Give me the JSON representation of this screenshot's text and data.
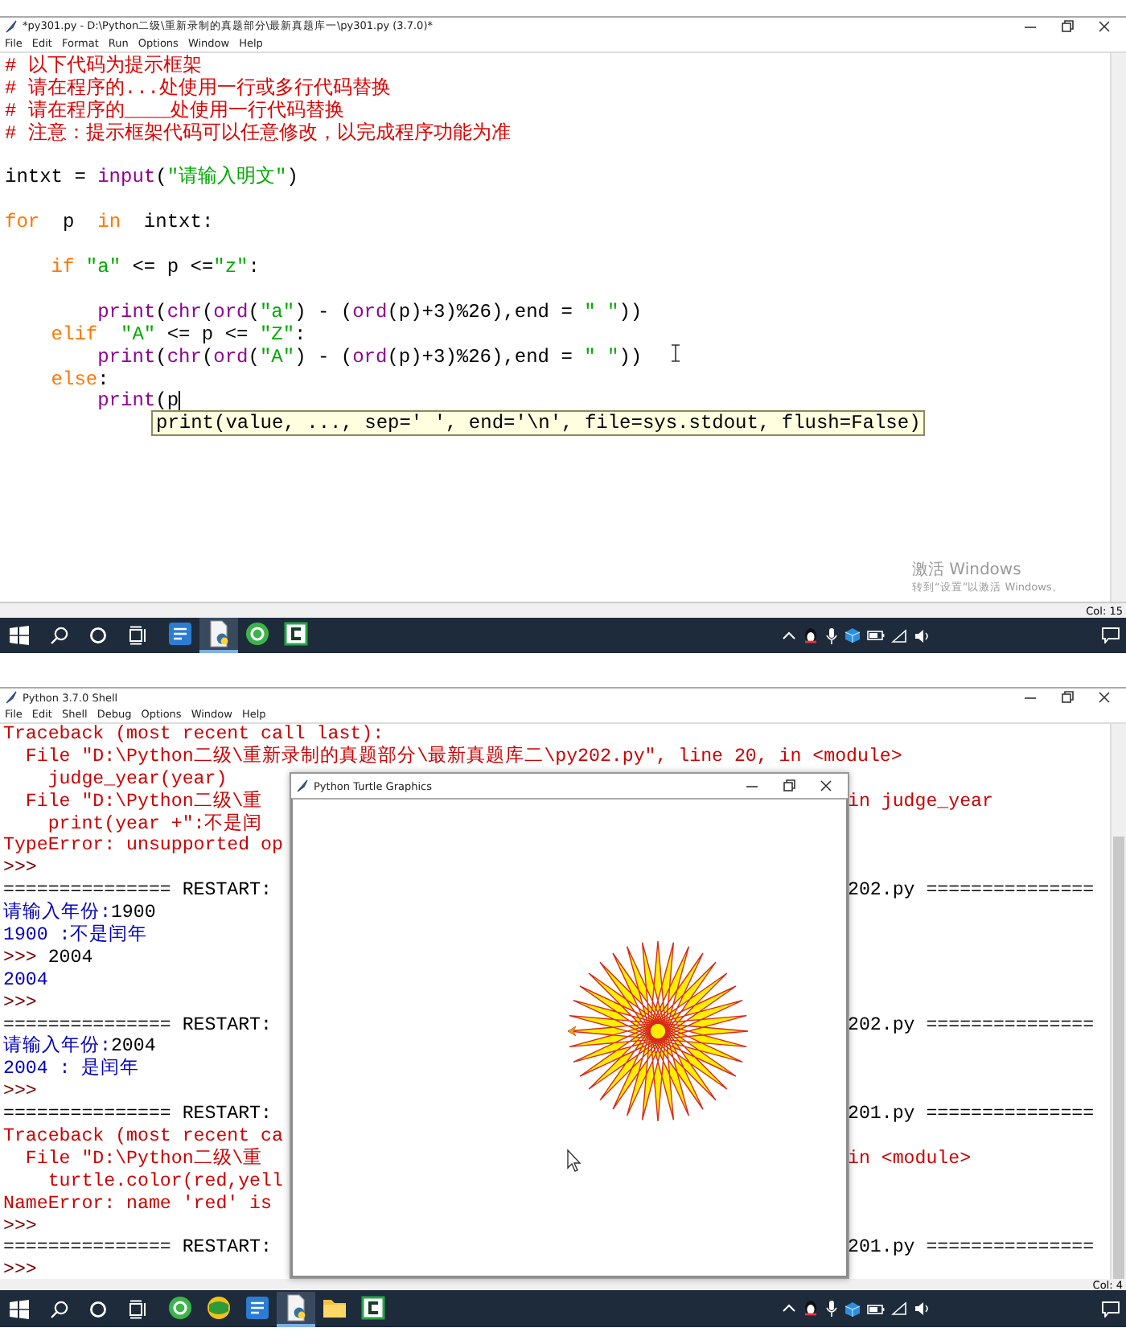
{
  "editor_window": {
    "title": "*py301.py - D:\\Python二级\\重新录制的真题部分\\最新真题库一\\py301.py (3.7.0)*",
    "menu": [
      "File",
      "Edit",
      "Format",
      "Run",
      "Options",
      "Window",
      "Help"
    ],
    "lines": [
      {
        "blank_before": false,
        "caret": false,
        "tokens": [
          {
            "text": "# 以下代码为提示框架",
            "kind": "comment"
          }
        ]
      },
      {
        "blank_before": false,
        "caret": false,
        "tokens": [
          {
            "text": "# 请在程序的...处使用一行或多行代码替换",
            "kind": "comment"
          }
        ]
      },
      {
        "blank_before": false,
        "caret": false,
        "tokens": [
          {
            "text": "# 请在程序的____处使用一行代码替换",
            "kind": "comment"
          }
        ]
      },
      {
        "blank_before": false,
        "caret": false,
        "tokens": [
          {
            "text": "# 注意：提示框架代码可以任意修改，以完成程序功能为准",
            "kind": "comment"
          }
        ]
      },
      {
        "blank_before": true,
        "caret": false,
        "tokens": [
          {
            "text": "intxt = ",
            "kind": "plain"
          },
          {
            "text": "input",
            "kind": "builtin"
          },
          {
            "text": "(",
            "kind": "plain"
          },
          {
            "text": "\"请输入明文\"",
            "kind": "string"
          },
          {
            "text": ")",
            "kind": "plain"
          }
        ]
      },
      {
        "blank_before": true,
        "caret": false,
        "tokens": [
          {
            "text": "for",
            "kind": "keyword"
          },
          {
            "text": "  p  ",
            "kind": "plain"
          },
          {
            "text": "in",
            "kind": "keyword"
          },
          {
            "text": "  intxt:",
            "kind": "plain"
          }
        ]
      },
      {
        "blank_before": true,
        "caret": false,
        "tokens": [
          {
            "text": "    if ",
            "kind": "keyword"
          },
          {
            "text": "\"a\"",
            "kind": "string"
          },
          {
            "text": " <= p <=",
            "kind": "plain"
          },
          {
            "text": "\"z\"",
            "kind": "string"
          },
          {
            "text": ":",
            "kind": "plain"
          }
        ]
      },
      {
        "blank_before": true,
        "caret": false,
        "tokens": [
          {
            "text": "        print",
            "kind": "builtin"
          },
          {
            "text": "(",
            "kind": "plain"
          },
          {
            "text": "chr",
            "kind": "builtin"
          },
          {
            "text": "(",
            "kind": "plain"
          },
          {
            "text": "ord",
            "kind": "builtin"
          },
          {
            "text": "(",
            "kind": "plain"
          },
          {
            "text": "\"a\"",
            "kind": "string"
          },
          {
            "text": ") - (",
            "kind": "plain"
          },
          {
            "text": "ord",
            "kind": "builtin"
          },
          {
            "text": "(p)+3)%26),end = ",
            "kind": "plain"
          },
          {
            "text": "\" \"",
            "kind": "string"
          },
          {
            "text": "))",
            "kind": "plain"
          }
        ]
      },
      {
        "blank_before": false,
        "caret": false,
        "tokens": [
          {
            "text": "    elif  ",
            "kind": "keyword"
          },
          {
            "text": "\"A\"",
            "kind": "string"
          },
          {
            "text": " <= p <= ",
            "kind": "plain"
          },
          {
            "text": "\"Z\"",
            "kind": "string"
          },
          {
            "text": ":",
            "kind": "plain"
          }
        ]
      },
      {
        "blank_before": false,
        "caret": false,
        "tokens": [
          {
            "text": "        print",
            "kind": "builtin"
          },
          {
            "text": "(",
            "kind": "plain"
          },
          {
            "text": "chr",
            "kind": "builtin"
          },
          {
            "text": "(",
            "kind": "plain"
          },
          {
            "text": "ord",
            "kind": "builtin"
          },
          {
            "text": "(",
            "kind": "plain"
          },
          {
            "text": "\"A\"",
            "kind": "string"
          },
          {
            "text": ") - (",
            "kind": "plain"
          },
          {
            "text": "ord",
            "kind": "builtin"
          },
          {
            "text": "(p)+3)%26),end = ",
            "kind": "plain"
          },
          {
            "text": "\" \"",
            "kind": "string"
          },
          {
            "text": "))",
            "kind": "plain"
          }
        ]
      },
      {
        "blank_before": false,
        "caret": false,
        "tokens": [
          {
            "text": "    else",
            "kind": "keyword"
          },
          {
            "text": ":",
            "kind": "plain"
          }
        ]
      },
      {
        "blank_before": false,
        "caret": true,
        "tokens": [
          {
            "text": "        print",
            "kind": "builtin"
          },
          {
            "text": "(p",
            "kind": "plain"
          }
        ]
      }
    ],
    "tooltip": "print(value, ..., sep=' ', end='\\n', file=sys.stdout, flush=False)",
    "status": "Col: 15"
  },
  "activation_notice": {
    "title": "激活 Windows",
    "hint": "转到“设置”以激活 Windows。"
  },
  "taskbar_top": {
    "apps": [
      {
        "kind": "word",
        "selected": false
      },
      {
        "kind": "python",
        "selected": true
      },
      {
        "kind": "green-circle",
        "selected": false
      },
      {
        "kind": "c-app",
        "selected": false
      }
    ]
  },
  "shell_window": {
    "title": "Python 3.7.0 Shell",
    "menu": [
      "File",
      "Edit",
      "Shell",
      "Debug",
      "Options",
      "Window",
      "Help"
    ],
    "lines": [
      {
        "segments": [
          {
            "text": "Traceback (most recent call last):",
            "kind": "error"
          }
        ]
      },
      {
        "segments": [
          {
            "text": "  File \"D:\\Python二级\\重新录制的真题部分\\最新真题库二\\py202.py\", line 20, in <module>",
            "kind": "error"
          }
        ]
      },
      {
        "segments": [
          {
            "text": "    judge_year(year)",
            "kind": "error"
          }
        ]
      },
      {
        "segments": [
          {
            "text": "  File \"D:\\Python二级\\重",
            "kind": "error"
          }
        ],
        "tail": {
          "text": "in judge_year",
          "kind": "error"
        }
      },
      {
        "segments": [
          {
            "text": "    print(year +\":不是闰",
            "kind": "error"
          }
        ]
      },
      {
        "segments": [
          {
            "text": "TypeError: unsupported op",
            "kind": "error"
          }
        ]
      },
      {
        "segments": [
          {
            "text": ">>>",
            "kind": "prompt"
          }
        ]
      },
      {
        "segments": [
          {
            "text": "=============== RESTART:",
            "kind": "plain"
          }
        ],
        "tail": {
          "text": "202.py ===============",
          "kind": "plain"
        }
      },
      {
        "segments": [
          {
            "text": "请输入年份:",
            "kind": "output"
          },
          {
            "text": "1900",
            "kind": "plain"
          }
        ]
      },
      {
        "segments": [
          {
            "text": "1900 :不是闰年",
            "kind": "output"
          }
        ]
      },
      {
        "segments": [
          {
            "text": ">>> ",
            "kind": "prompt"
          },
          {
            "text": "2004",
            "kind": "plain"
          }
        ]
      },
      {
        "segments": [
          {
            "text": "2004",
            "kind": "output"
          }
        ]
      },
      {
        "segments": [
          {
            "text": ">>>",
            "kind": "prompt"
          }
        ]
      },
      {
        "segments": [
          {
            "text": "=============== RESTART:",
            "kind": "plain"
          }
        ],
        "tail": {
          "text": "202.py ===============",
          "kind": "plain"
        }
      },
      {
        "segments": [
          {
            "text": "请输入年份:",
            "kind": "output"
          },
          {
            "text": "2004",
            "kind": "plain"
          }
        ]
      },
      {
        "segments": [
          {
            "text": "2004 : 是闰年",
            "kind": "output"
          }
        ]
      },
      {
        "segments": [
          {
            "text": ">>>",
            "kind": "prompt"
          }
        ]
      },
      {
        "segments": [
          {
            "text": "=============== RESTART:",
            "kind": "plain"
          }
        ],
        "tail": {
          "text": "201.py ===============",
          "kind": "plain"
        }
      },
      {
        "segments": [
          {
            "text": "Traceback (most recent ca",
            "kind": "error"
          }
        ]
      },
      {
        "segments": [
          {
            "text": "  File \"D:\\Python二级\\重",
            "kind": "error"
          }
        ],
        "tail": {
          "text": "in <module>",
          "kind": "error"
        }
      },
      {
        "segments": [
          {
            "text": "    turtle.color(red,yell",
            "kind": "error"
          }
        ]
      },
      {
        "segments": [
          {
            "text": "NameError: name 'red' is",
            "kind": "error"
          }
        ]
      },
      {
        "segments": [
          {
            "text": ">>>",
            "kind": "prompt"
          }
        ]
      },
      {
        "segments": [
          {
            "text": "=============== RESTART:",
            "kind": "plain"
          }
        ],
        "tail": {
          "text": "201.py ===============",
          "kind": "plain"
        }
      },
      {
        "segments": [
          {
            "text": ">>>",
            "kind": "prompt"
          }
        ]
      }
    ],
    "status": "Col: 4"
  },
  "turtle_window": {
    "title": "Python Turtle Graphics"
  },
  "taskbar_bottom": {
    "apps": [
      {
        "kind": "green-circle",
        "selected": false
      },
      {
        "kind": "green-ball",
        "selected": false
      },
      {
        "kind": "word",
        "selected": false
      },
      {
        "kind": "python",
        "selected": true
      },
      {
        "kind": "folder",
        "selected": false
      },
      {
        "kind": "c-app",
        "selected": false
      }
    ]
  }
}
